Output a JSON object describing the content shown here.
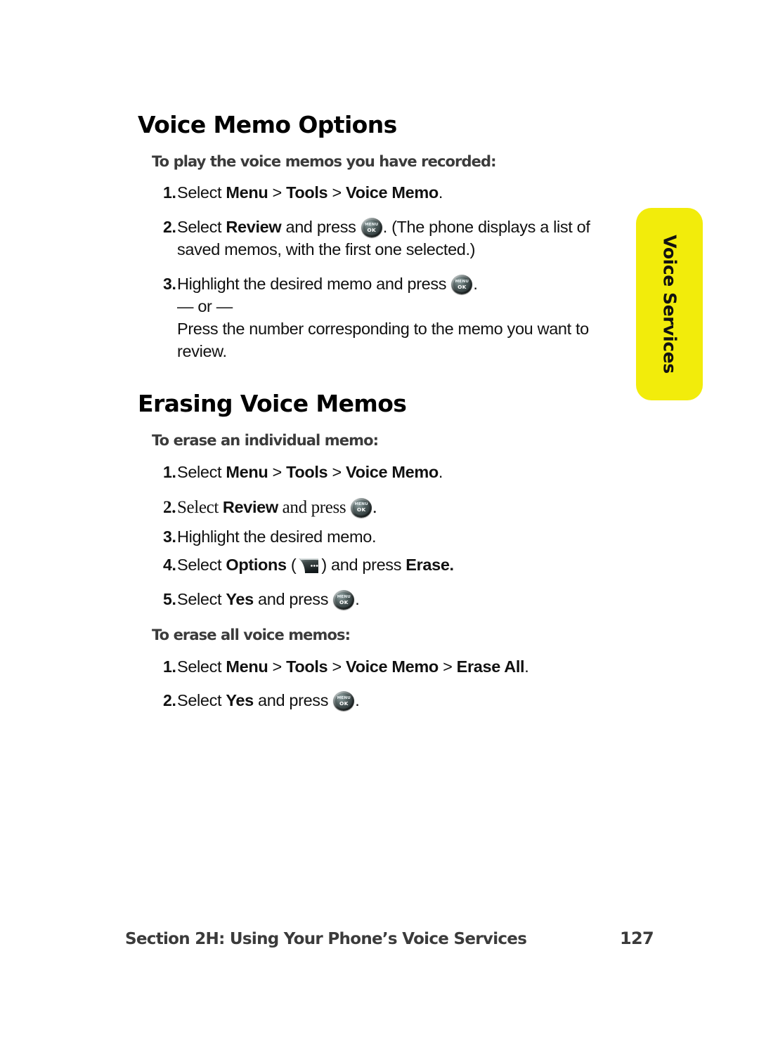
{
  "page": {
    "number": "127",
    "footer_title": "Section 2H: Using Your Phone’s Voice Services"
  },
  "side_tab": {
    "label": "Voice Services",
    "color": "#f2ec0b"
  },
  "sections": [
    {
      "heading": "Voice Memo Options",
      "subheading": "To play the voice memos you have recorded:",
      "steps": [
        {
          "num": "1.",
          "parts": [
            {
              "t": "Select ",
              "b": false
            },
            {
              "t": "Menu",
              "b": true
            },
            {
              "t": " > ",
              "b": false
            },
            {
              "t": "Tools",
              "b": true
            },
            {
              "t": " > ",
              "b": false
            },
            {
              "t": "Voice Memo",
              "b": true
            },
            {
              "t": ".",
              "b": false
            }
          ]
        },
        {
          "num": "2.",
          "parts": [
            {
              "t": "Select ",
              "b": false
            },
            {
              "t": "Review",
              "b": true
            },
            {
              "t": " and press ",
              "b": false
            },
            {
              "t": "@menukey",
              "b": false
            },
            {
              "t": ". (The phone displays a list of saved memos, with the first one selected.)",
              "b": false
            }
          ]
        },
        {
          "num": "3.",
          "parts": [
            {
              "t": "Highlight the desired memo and press ",
              "b": false
            },
            {
              "t": "@menukey",
              "b": false
            },
            {
              "t": ".",
              "b": false
            },
            {
              "t": "@br",
              "b": false
            },
            {
              "t": "— or —",
              "b": false
            },
            {
              "t": "@br",
              "b": false
            },
            {
              "t": "Press the number corresponding to the memo you want to review.",
              "b": false
            }
          ]
        }
      ]
    },
    {
      "heading": "Erasing Voice Memos",
      "subheading": "To erase an individual memo:",
      "steps": [
        {
          "num": "1.",
          "parts": [
            {
              "t": "Select ",
              "b": false
            },
            {
              "t": "Menu",
              "b": true
            },
            {
              "t": " > ",
              "b": false
            },
            {
              "t": "Tools",
              "b": true
            },
            {
              "t": " > ",
              "b": false
            },
            {
              "t": "Voice Memo",
              "b": true
            },
            {
              "t": ".",
              "b": false
            }
          ]
        },
        {
          "num": "2.",
          "serif": true,
          "parts": [
            {
              "t": "Select ",
              "b": false
            },
            {
              "t": "Review",
              "b": true
            },
            {
              "t": " and press ",
              "b": false
            },
            {
              "t": "@menukey",
              "b": false
            },
            {
              "t": ".",
              "b": false
            }
          ]
        },
        {
          "num": "3.",
          "parts": [
            {
              "t": "Highlight the desired memo.",
              "b": false
            }
          ]
        },
        {
          "num": "4.",
          "parts": [
            {
              "t": "Select ",
              "b": false
            },
            {
              "t": "Options",
              "b": true
            },
            {
              "t": " (",
              "b": false
            },
            {
              "t": "@softkey",
              "b": false
            },
            {
              "t": ") and press ",
              "b": false
            },
            {
              "t": "Erase.",
              "b": true
            }
          ]
        },
        {
          "num": "5.",
          "parts": [
            {
              "t": "Select ",
              "b": false
            },
            {
              "t": "Yes",
              "b": true
            },
            {
              "t": " and press ",
              "b": false
            },
            {
              "t": "@menukey",
              "b": false
            },
            {
              "t": ".",
              "b": false
            }
          ]
        }
      ]
    },
    {
      "heading": null,
      "subheading": "To erase all voice memos:",
      "steps": [
        {
          "num": "1.",
          "parts": [
            {
              "t": "Select ",
              "b": false
            },
            {
              "t": "Menu",
              "b": true
            },
            {
              "t": " > ",
              "b": false
            },
            {
              "t": "Tools",
              "b": true
            },
            {
              "t": " > ",
              "b": false
            },
            {
              "t": "Voice Memo",
              "b": true
            },
            {
              "t": " > ",
              "b": false
            },
            {
              "t": "Erase All",
              "b": true
            },
            {
              "t": ".",
              "b": false
            }
          ]
        },
        {
          "num": "2.",
          "parts": [
            {
              "t": "Select ",
              "b": false
            },
            {
              "t": "Yes",
              "b": true
            },
            {
              "t": " and press ",
              "b": false
            },
            {
              "t": "@menukey",
              "b": false
            },
            {
              "t": ".",
              "b": false
            }
          ]
        }
      ]
    }
  ],
  "icons": {
    "menu_ok_key": {
      "name": "menu-ok-key-icon",
      "line1": "MENU",
      "line2": "OK"
    },
    "options_softkey": {
      "name": "options-softkey-icon",
      "dots": "•••"
    }
  }
}
